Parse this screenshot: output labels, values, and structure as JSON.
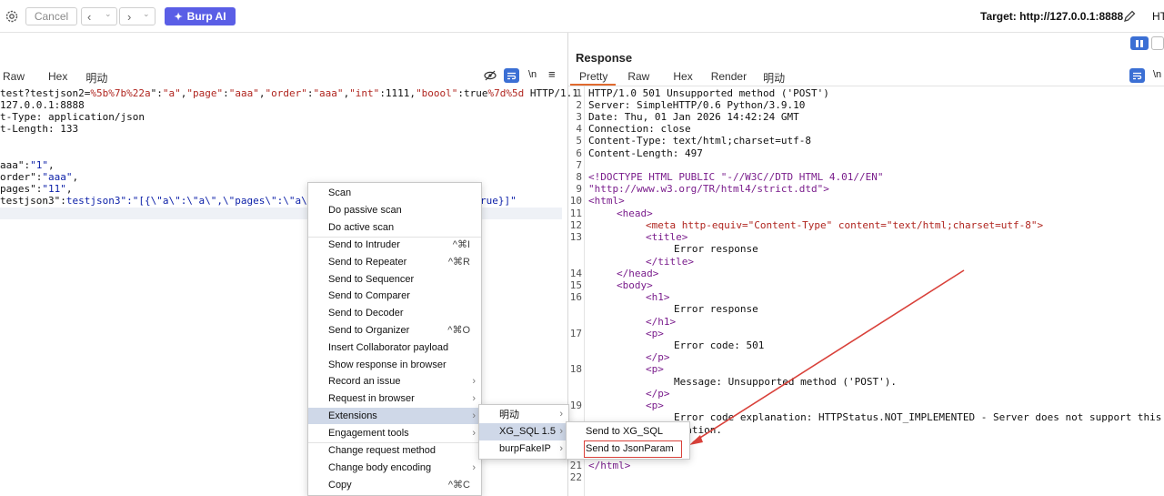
{
  "toolbar": {
    "cancel_label": "Cancel",
    "prev_label": "<",
    "next_label": ">",
    "burp_ai_label": "Burp AI",
    "target_label": "Target: http://127.0.0.1:8888",
    "http_cut": "HTT"
  },
  "request": {
    "tabs": [
      "Raw",
      "Hex",
      "明动"
    ],
    "newline_label": "\\n",
    "lines": [
      "test?testjson2=%5b%7b%22a\":\"a\",\"page\":\"aaa\",\"order\":\"aaa\",\"int\":1111,\"boool\":true%7d%5d HTTP/1.1",
      "127.0.0.1:8888",
      "t-Type: application/json",
      "t-Length: 133",
      "",
      "",
      "aaa\":\"1\",",
      "order\":\"aaa\",",
      "pages\":\"11\",",
      "testjson3\":\"[{\\\"a\\\":\\\"a\\\",\\\"pages\\\":\\\"a\\\",\\\"sort\\\":\\\"aa",
      "rue}]\""
    ]
  },
  "response": {
    "title": "Response",
    "tabs": [
      "Pretty",
      "Raw",
      "Hex",
      "Render",
      "明动"
    ],
    "newline_label": "\\n",
    "line_numbers": [
      "1",
      "2",
      "3",
      "4",
      "5",
      "6",
      "7",
      "8",
      "9",
      "10",
      "11",
      "12",
      "13",
      "14",
      "15",
      "16",
      "17",
      "18",
      "19",
      "21",
      "22"
    ],
    "lines": [
      "HTTP/1.0 501 Unsupported method ('POST')",
      "Server: SimpleHTTP/0.6 Python/3.9.10",
      "Date: Thu, 01 Jan 2026 14:42:24 GMT",
      "Connection: close",
      "Content-Type: text/html;charset=utf-8",
      "Content-Length: 497",
      "",
      "<!DOCTYPE HTML PUBLIC \"-//W3C//DTD HTML 4.01//EN\"",
      "\"http://www.w3.org/TR/html4/strict.dtd\">",
      "<html>",
      "<head>",
      "<meta http-equiv=\"Content-Type\" content=\"text/html;charset=utf-8\">",
      "<title>",
      "Error response",
      "</title>",
      "</head>",
      "<body>",
      "<h1>",
      "Error response",
      "</h1>",
      "<p>",
      "Error code: 501",
      "</p>",
      "<p>",
      "Message: Unsupported method ('POST').",
      "</p>",
      "<p>",
      "Error code explanation: HTTPStatus.NOT_IMPLEMENTED - Server does not support this",
      "eration.",
      "</html>"
    ]
  },
  "context_menu": {
    "items": [
      {
        "label": "Scan"
      },
      {
        "label": "Do passive scan"
      },
      {
        "label": "Do active scan"
      },
      {
        "label": "Send to Intruder",
        "shortcut": "^⌘I"
      },
      {
        "label": "Send to Repeater",
        "shortcut": "^⌘R"
      },
      {
        "label": "Send to Sequencer"
      },
      {
        "label": "Send to Comparer"
      },
      {
        "label": "Send to Decoder"
      },
      {
        "label": "Send to Organizer",
        "shortcut": "^⌘O"
      },
      {
        "label": "Insert Collaborator payload"
      },
      {
        "label": "Show response in browser"
      },
      {
        "label": "Record an issue",
        "submenu": "›"
      },
      {
        "label": "Request in browser",
        "submenu": "›"
      },
      {
        "label": "Extensions",
        "submenu": "›"
      },
      {
        "label": "Engagement tools",
        "submenu": "›"
      },
      {
        "label": "Change request method"
      },
      {
        "label": "Change body encoding",
        "submenu": "›"
      },
      {
        "label": "Copy",
        "shortcut": "^⌘C"
      }
    ]
  },
  "extensions_menu": {
    "items": [
      {
        "label": "明动",
        "submenu": "›"
      },
      {
        "label": "XG_SQL 1.5",
        "submenu": "›"
      },
      {
        "label": "burpFakeIP",
        "submenu": "›"
      }
    ]
  },
  "xg_sql_menu": {
    "items": [
      {
        "label": "Send to XG_SQL"
      },
      {
        "label": "Send to JsonParam"
      }
    ]
  },
  "colors": {
    "accent": "#5a5ee6",
    "highlight": "#cfd8e8",
    "annotation": "#d9413a"
  }
}
